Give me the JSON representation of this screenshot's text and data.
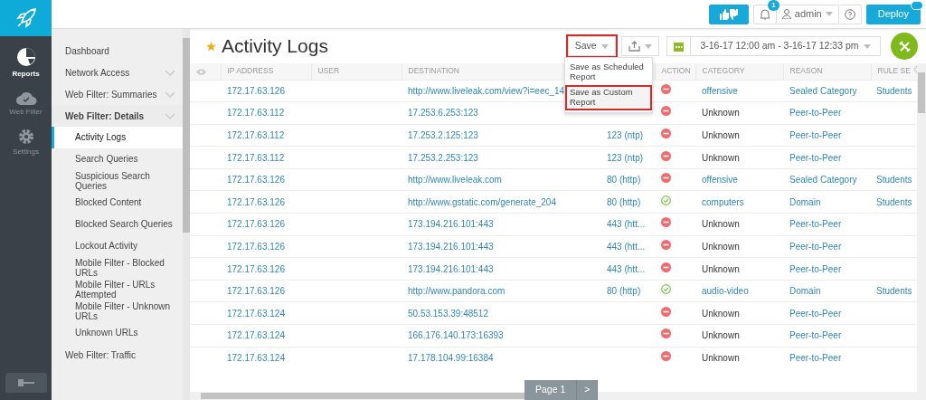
{
  "topbar": {
    "notification_count": "1",
    "user": "admin",
    "deploy": "Deploy"
  },
  "rail": [
    {
      "label": "Reports",
      "kind": "reports",
      "selected": true
    },
    {
      "label": "Web Filter",
      "kind": "filter",
      "selected": false
    },
    {
      "label": "Settings",
      "kind": "settings",
      "selected": false
    }
  ],
  "sidebar": [
    {
      "label": "Dashboard",
      "expandable": false,
      "selected": false
    },
    {
      "label": "Network Access",
      "expandable": true,
      "selected": false
    },
    {
      "label": "Web Filter: Summaries",
      "expandable": true,
      "selected": false
    },
    {
      "label": "Web Filter: Details",
      "expandable": true,
      "selected": false,
      "expanded": true,
      "children": [
        {
          "label": "Activity Logs",
          "selected": true
        },
        {
          "label": "Search Queries",
          "selected": false
        },
        {
          "label": "Suspicious Search Queries",
          "selected": false
        },
        {
          "label": "Blocked Content",
          "selected": false
        },
        {
          "label": "Blocked Search Queries",
          "selected": false
        },
        {
          "label": "Lockout Activity",
          "selected": false
        },
        {
          "label": "Mobile Filter - Blocked URLs",
          "selected": false
        },
        {
          "label": "Mobile Filter - URLs Attempted",
          "selected": false
        },
        {
          "label": "Mobile Filter - Unknown URLs",
          "selected": false
        },
        {
          "label": "Unknown URLs",
          "selected": false
        }
      ]
    },
    {
      "label": "Web Filter: Traffic",
      "expandable": false,
      "selected": false
    }
  ],
  "page": {
    "title": "Activity Logs",
    "favorite": true,
    "save": "Save",
    "save_highlighted": true,
    "date_range": "3-16-17 12:00 am - 3-16-17 12:33 pm"
  },
  "save_menu": [
    {
      "label": "Save as Scheduled Report",
      "highlighted": false
    },
    {
      "label": "Save as Custom Report",
      "highlighted": true
    }
  ],
  "table": {
    "columns": [
      "IP ADDRESS",
      "USER",
      "DESTINATION",
      "ACTION",
      "CATEGORY",
      "REASON",
      "RULE SE"
    ],
    "rows": [
      {
        "ip": "172.17.63.126",
        "destination": "http://www.liveleak.com/view?i=eec_14",
        "blocked": true,
        "category": "offensive",
        "category_linked": true,
        "reason": "Sealed Category",
        "rule_set": "Students"
      },
      {
        "ip": "172.17.63.112",
        "destination": "17.253.6.253:123",
        "blocked": true,
        "category": "Unknown",
        "category_linked": false,
        "reason": "Peer-to-Peer"
      },
      {
        "ip": "172.17.63.112",
        "destination": "17.253.2.125:123",
        "port": "123 (ntp)",
        "blocked": true,
        "category": "Unknown",
        "category_linked": false,
        "reason": "Peer-to-Peer"
      },
      {
        "ip": "172.17.63.112",
        "destination": "17.253.2.253:123",
        "port": "123 (ntp)",
        "blocked": true,
        "category": "Unknown",
        "category_linked": false,
        "reason": "Peer-to-Peer"
      },
      {
        "ip": "172.17.63.126",
        "destination": "http://www.liveleak.com",
        "port": "80 (http)",
        "blocked": true,
        "category": "offensive",
        "category_linked": true,
        "reason": "Sealed Category",
        "rule_set": "Students"
      },
      {
        "ip": "172.17.63.126",
        "destination": "http://www.gstatic.com/generate_204",
        "port": "80 (http)",
        "blocked": false,
        "category": "computers",
        "category_linked": true,
        "reason": "Domain",
        "rule_set": "Students"
      },
      {
        "ip": "172.17.63.126",
        "destination": "173.194.216.101:443",
        "port": "443 (htt...",
        "blocked": true,
        "category": "Unknown",
        "category_linked": false,
        "reason": "Peer-to-Peer"
      },
      {
        "ip": "172.17.63.126",
        "destination": "173.194.216.101:443",
        "port": "443 (htt...",
        "blocked": true,
        "category": "Unknown",
        "category_linked": false,
        "reason": "Peer-to-Peer"
      },
      {
        "ip": "172.17.63.126",
        "destination": "173.194.216.101:443",
        "port": "443 (htt...",
        "blocked": true,
        "category": "Unknown",
        "category_linked": false,
        "reason": "Peer-to-Peer"
      },
      {
        "ip": "172.17.63.126",
        "destination": "http://www.pandora.com",
        "port": "80 (http)",
        "blocked": false,
        "category": "audio-video",
        "category_linked": true,
        "reason": "Domain",
        "rule_set": "Students"
      },
      {
        "ip": "172.17.63.124",
        "destination": "50.53.153.39:48512",
        "blocked": true,
        "category": "Unknown",
        "category_linked": false,
        "reason": "Peer-to-Peer"
      },
      {
        "ip": "172.17.63.124",
        "destination": "166.176.140.173:16393",
        "blocked": true,
        "category": "Unknown",
        "category_linked": false,
        "reason": "Peer-to-Peer"
      },
      {
        "ip": "172.17.63.124",
        "destination": "17.178.104.99:16384",
        "blocked": true,
        "category": "Unknown",
        "category_linked": false,
        "reason": "Peer-to-Peer"
      }
    ]
  },
  "pager": {
    "label": "Page 1",
    "next": ">"
  }
}
